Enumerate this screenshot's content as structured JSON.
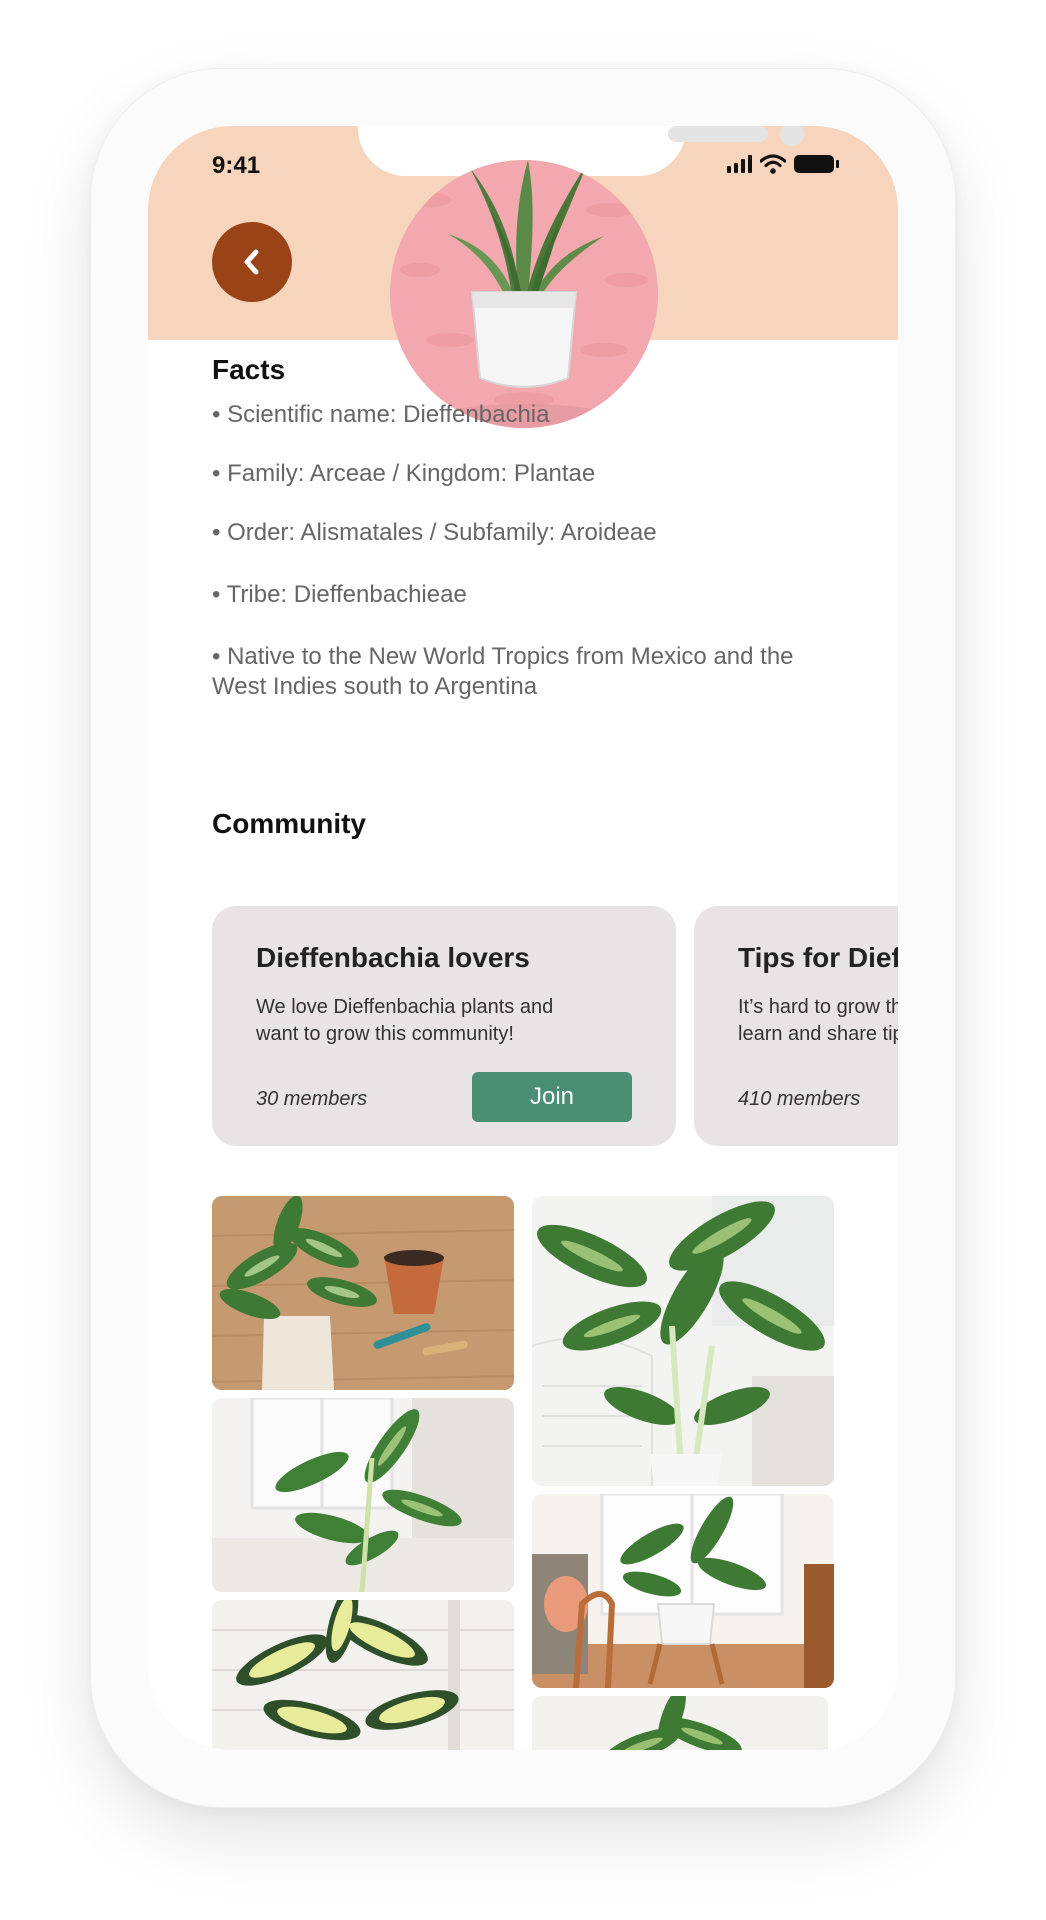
{
  "status_bar": {
    "time": "9:41"
  },
  "header": {
    "back_icon": "chevron-left-icon",
    "plant_image": "snake-plant-in-white-pot"
  },
  "facts": {
    "title": "Facts",
    "items": [
      "• Scientific name: Dieffenbachia",
      "• Family: Arceae / Kingdom: Plantae",
      "• Order: Alismatales / Subfamily: Aroideae",
      "• Tribe: Dieffenbachieae",
      "• Native to the New World Tropics from Mexico and the West Indies south to Argentina"
    ]
  },
  "community": {
    "title": "Community",
    "cards": [
      {
        "title": "Dieffenbachia lovers",
        "description": "We love Dieffenbachia plants and want to grow this community!",
        "members": "30 members",
        "join_label": "Join"
      },
      {
        "title": "Tips for Dieffenbachia",
        "description": "It’s hard to grow them? Come here to learn and share tips!",
        "members": "410 members"
      }
    ]
  },
  "gallery": {
    "images": [
      "dieffenbachia-with-pots-and-tools",
      "tall-dieffenbachia-by-chair",
      "dieffenbachia-by-window",
      "dieffenbachia-on-wooden-stand",
      "variegated-yellow-dieffenbachia",
      "dieffenbachia-close-up"
    ]
  },
  "colors": {
    "header_background": "#f6d5bc",
    "back_button": "#9a4317",
    "avatar_background": "#f2a8ae",
    "card_background": "#e8e4e5",
    "join_button": "#4a8f73"
  }
}
